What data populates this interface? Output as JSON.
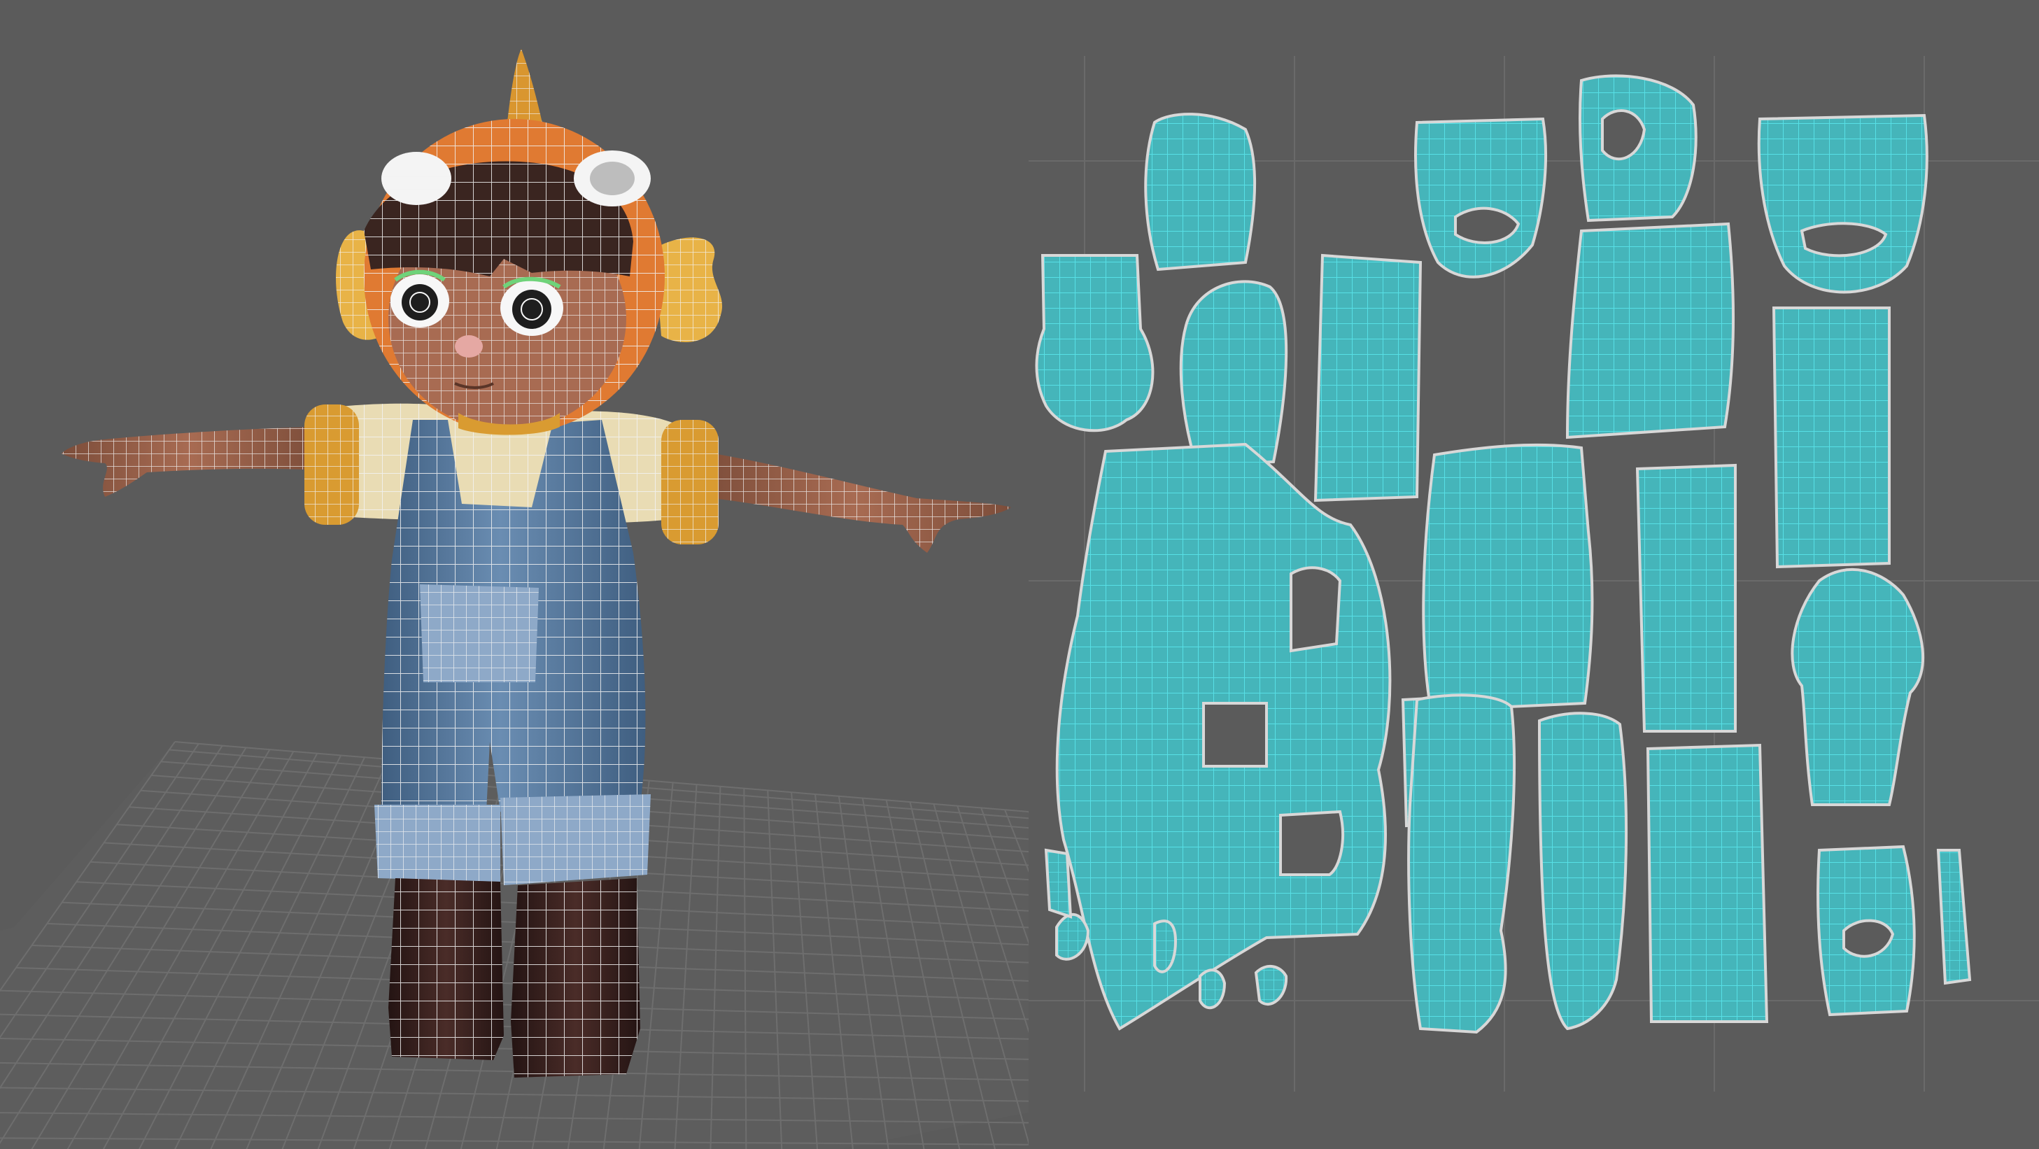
{
  "scene": {
    "character": "chibi-character",
    "colors": {
      "background": "#5b5b5b",
      "grid_line": "#6c6c6c",
      "wire": "#f2f2f2",
      "skin": "#a86b52",
      "skin_dark": "#7c4d3a",
      "hair": "#3a2520",
      "helmet_orange": "#e07a32",
      "fin_yellow": "#e8b347",
      "shirt_cream": "#e9dcb4",
      "cuff_gold": "#d99b31",
      "overalls_blue": "#5d7fa3",
      "overalls_dark": "#3f5e80",
      "pocket_light": "#8ea9c8",
      "boots": "#3a2321",
      "uv_shell_fill": "#45b5ba",
      "uv_shell_wire": "#57e0e6",
      "uv_border": "#d8d8d8"
    }
  },
  "uv_editor": {
    "shell_count": 24
  }
}
